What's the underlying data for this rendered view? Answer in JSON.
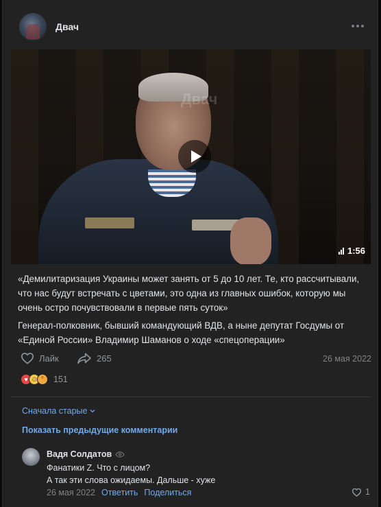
{
  "post": {
    "group_name": "Двач",
    "video": {
      "watermark": "Двач",
      "duration": "1:56"
    },
    "text_quote": "«Демилитаризация Украины может занять от 5 до 10 лет. Те, кто рассчитывали, что нас будут встречать с цветами, это одна из главных ошибок, которую мы очень остро почувствовали в первые пять суток»",
    "text_caption": "Генерал-полковник, бывший командующий ВДВ, а ныне депутат Госдумы от «Единой России» Владимир Шаманов о ходе «спецоперации»",
    "like_label": "Лайк",
    "share_count": "265",
    "date": "26 мая 2022",
    "reactions_count": "151"
  },
  "comments_section": {
    "sort_label": "Сначала старые",
    "show_previous_label": "Показать предыдущие комментарии",
    "comment": {
      "author": "Вадя Солдатов",
      "line1": "Фанатики Z. Что с лицом?",
      "line2": "А так эти слова ожидаемы. Дальше - хуже",
      "date": "26 мая 2022",
      "reply_label": "Ответить",
      "share_label": "Поделиться",
      "like_count": "1"
    }
  },
  "colors": {
    "background": "#222222",
    "link": "#71aaeb",
    "text": "#e1e3e6",
    "muted": "#939699"
  }
}
